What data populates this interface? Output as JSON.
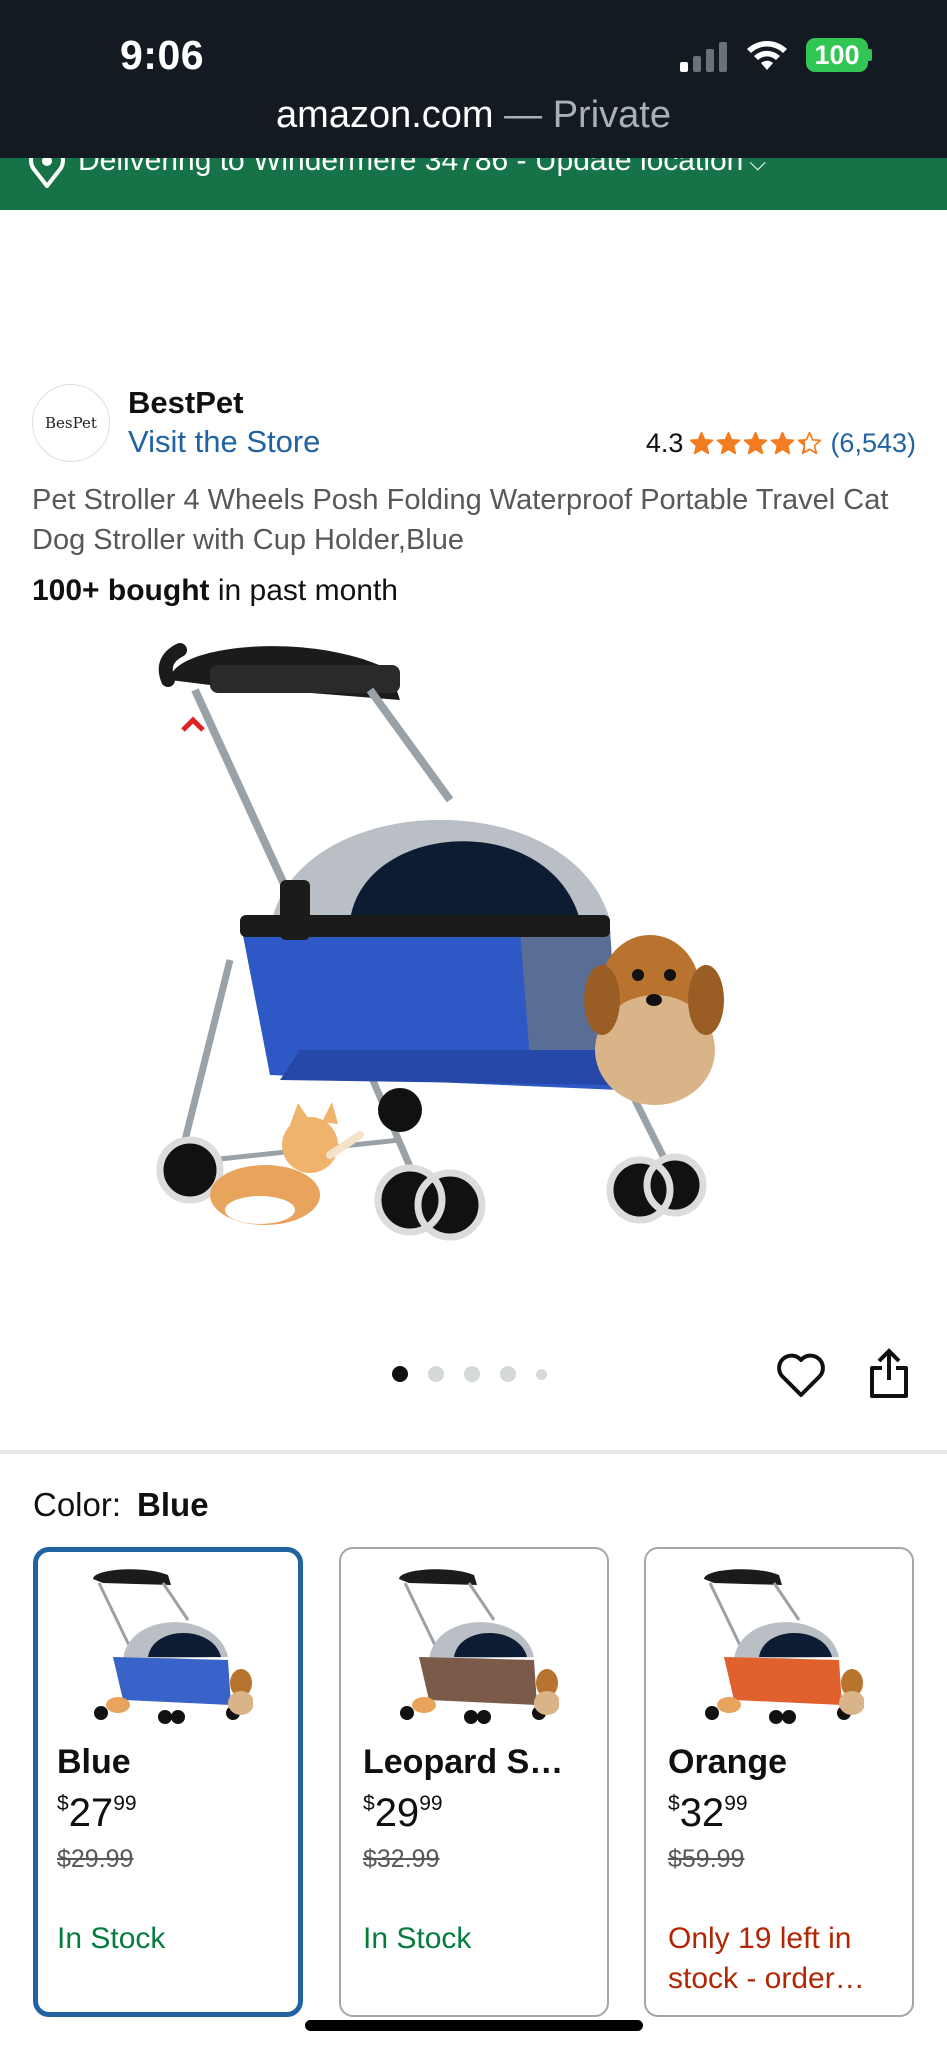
{
  "status": {
    "time": "9:06",
    "battery": "100"
  },
  "browser": {
    "host": "amazon.com",
    "mode": " — Private"
  },
  "location": {
    "text": "Delivering to Windermere 34786 - Update location",
    "chevron": "⌵"
  },
  "brand": {
    "logo_text": "BesPet",
    "name": "BestPet",
    "store_link": "Visit the Store"
  },
  "rating": {
    "value": "4.3",
    "stars": 4.3,
    "count": "(6,543)"
  },
  "product": {
    "title": "Pet Stroller 4 Wheels Posh Folding Waterproof Portable Travel Cat Dog Stroller with Cup Holder,Blue",
    "bought_bold": "100+ bought",
    "bought_rest": " in past month"
  },
  "carousel": {
    "total": 5,
    "active": 0
  },
  "color": {
    "label": "Color:",
    "value": "Blue"
  },
  "variants": [
    {
      "name": "Blue",
      "currency": "$",
      "whole": "27",
      "fraction": "99",
      "list_price": "$29.99",
      "stock": "In Stock",
      "stock_type": "ok",
      "fabric": "#3a63c9",
      "selected": true
    },
    {
      "name": "Leopard S…",
      "currency": "$",
      "whole": "29",
      "fraction": "99",
      "list_price": "$32.99",
      "stock": "In Stock",
      "stock_type": "ok",
      "fabric": "#7b5a4a",
      "selected": false
    },
    {
      "name": "Orange",
      "currency": "$",
      "whole": "32",
      "fraction": "99",
      "list_price": "$59.99",
      "stock": "Only 19 left in stock - order…",
      "stock_type": "low",
      "fabric": "#e0602e",
      "selected": false
    }
  ],
  "colors": {
    "topbar": "#131a22",
    "location_bar": "#157347",
    "link": "#2162a1",
    "star": "#f47c20",
    "in_stock": "#067d3e",
    "low_stock": "#b12704"
  }
}
